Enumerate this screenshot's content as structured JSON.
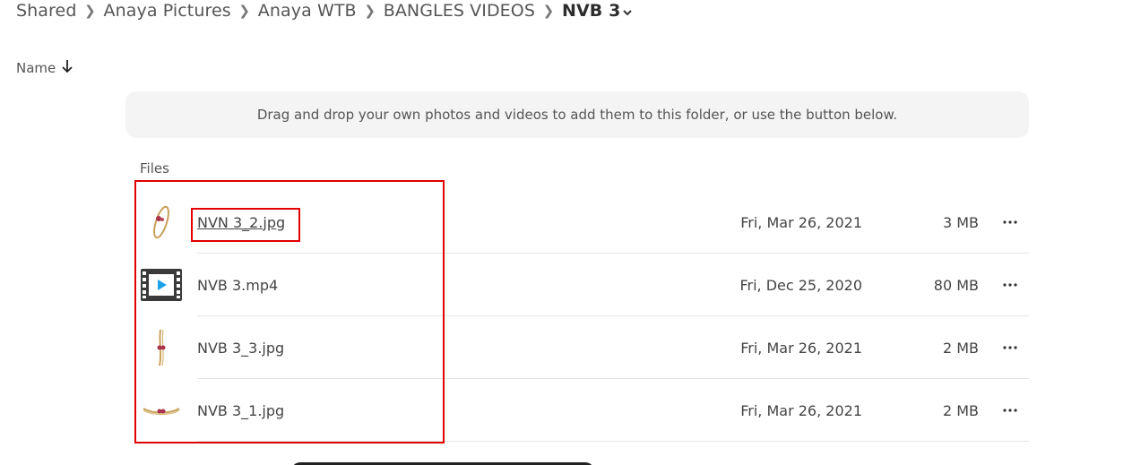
{
  "breadcrumb": {
    "items": [
      "Shared",
      "Anaya Pictures",
      "Anaya WTB",
      "BANGLES VIDEOS"
    ],
    "current": "NVB 3"
  },
  "sort": {
    "label": "Name"
  },
  "dropzone": {
    "text": "Drag and drop your own photos and videos to add them to this folder, or use the button below."
  },
  "files_label": "Files",
  "files": [
    {
      "name": "NVN 3_2.jpg",
      "date": "Fri, Mar 26, 2021",
      "size": "3 MB",
      "kind": "image"
    },
    {
      "name": "NVB 3.mp4",
      "date": "Fri, Dec 25, 2020",
      "size": "80 MB",
      "kind": "video"
    },
    {
      "name": "NVB 3_3.jpg",
      "date": "Fri, Mar 26, 2021",
      "size": "2 MB",
      "kind": "image"
    },
    {
      "name": "NVB 3_1.jpg",
      "date": "Fri, Mar 26, 2021",
      "size": "2 MB",
      "kind": "image"
    }
  ],
  "colors": {
    "highlight": "#e00000",
    "video_play": "#1aa3e8",
    "accent_bar": "#222222"
  }
}
